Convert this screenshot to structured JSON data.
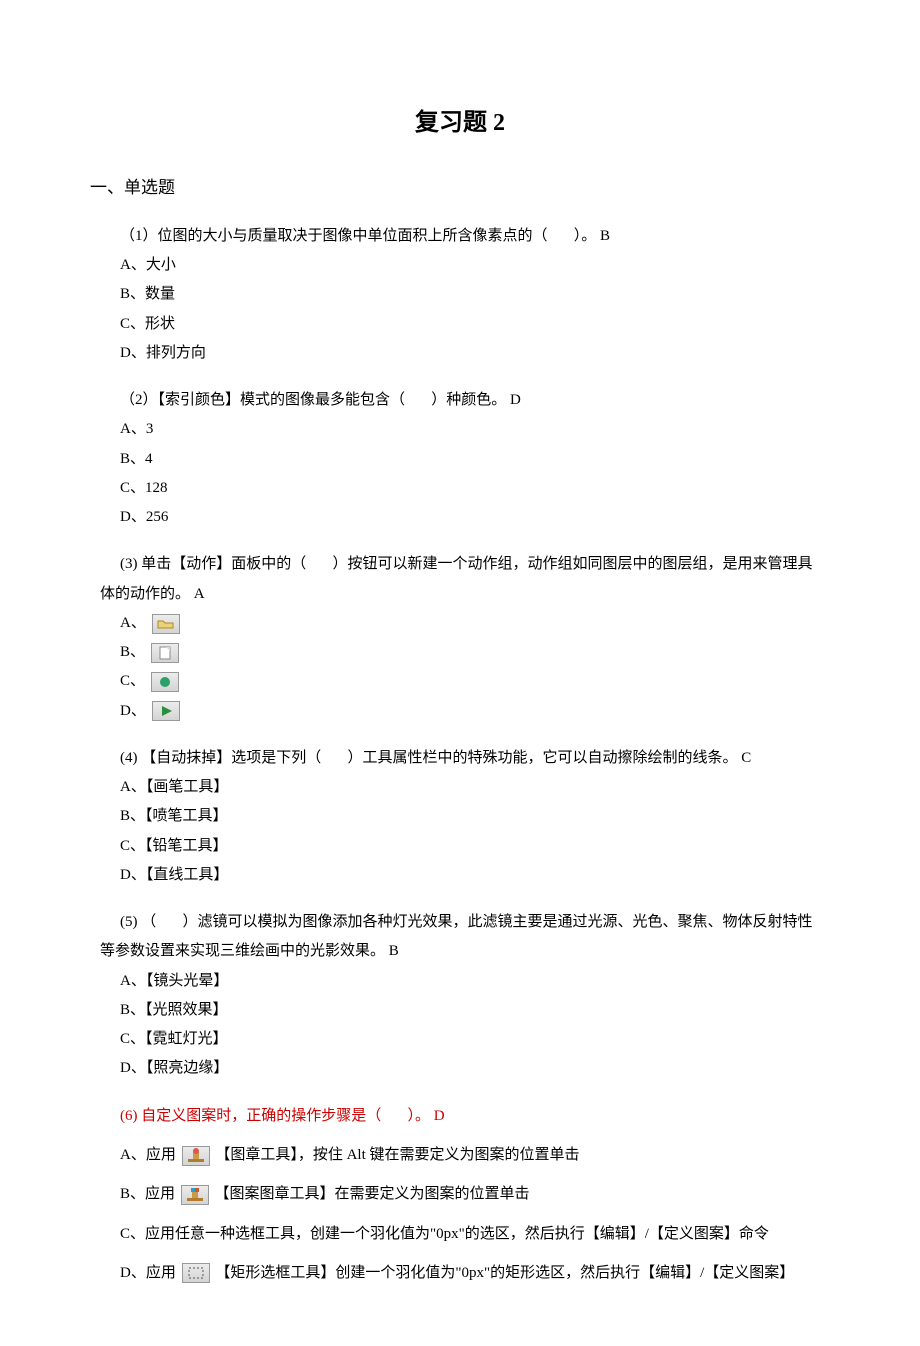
{
  "title": "复习题 2",
  "section1": "一、单选题",
  "q1": {
    "prompt_a": "（1）位图的大小与质量取决于图像中单位面积上所含像素点的（",
    "prompt_b": "）。",
    "ans": "B",
    "A": "A、大小",
    "B": "B、数量",
    "C": "C、形状",
    "D": "D、排列方向"
  },
  "q2": {
    "prompt_a": "（2）【索引颜色】模式的图像最多能包含（",
    "prompt_b": "）种颜色。",
    "ans": "D",
    "A": "A、3",
    "B": "B、4",
    "C": "C、128",
    "D": "D、256"
  },
  "q3": {
    "prompt_a": "(3) 单击【动作】面板中的（",
    "prompt_b": "）按钮可以新建一个动作组，动作组如同图层中的图层组，是用来管理具体的动作的。",
    "ans": "A",
    "A": "A、",
    "B": "B、",
    "C": "C、",
    "D": "D、"
  },
  "q4": {
    "prompt_a": "(4) 【自动抹掉】选项是下列（",
    "prompt_b": "）工具属性栏中的特殊功能，它可以自动擦除绘制的线条。",
    "ans": "C",
    "A": "A、【画笔工具】",
    "B": "B、【喷笔工具】",
    "C": "C、【铅笔工具】",
    "D": "D、【直线工具】"
  },
  "q5": {
    "prompt_a": "(5) （",
    "prompt_b": "）滤镜可以模拟为图像添加各种灯光效果，此滤镜主要是通过光源、光色、聚焦、物体反射特性等参数设置来实现三维绘画中的光影效果。",
    "ans": "B",
    "A": "A、【镜头光晕】",
    "B": "B、【光照效果】",
    "C": "C、【霓虹灯光】",
    "D": "D、【照亮边缘】"
  },
  "q6": {
    "prompt_a": "(6) 自定义图案时，正确的操作步骤是（",
    "prompt_b": "）。",
    "ans": "D",
    "A1": "A、应用",
    "A2": "【图章工具】，按住 Alt 键在需要定义为图案的位置单击",
    "B1": "B、应用",
    "B2": "【图案图章工具】在需要定义为图案的位置单击",
    "C": "C、应用任意一种选框工具，创建一个羽化值为\"0px\"的选区，然后执行【编辑】/【定义图案】命令",
    "D1": "D、应用",
    "D2": "【矩形选框工具】创建一个羽化值为\"0px\"的矩形选区，然后执行【编辑】/【定义图案】"
  }
}
